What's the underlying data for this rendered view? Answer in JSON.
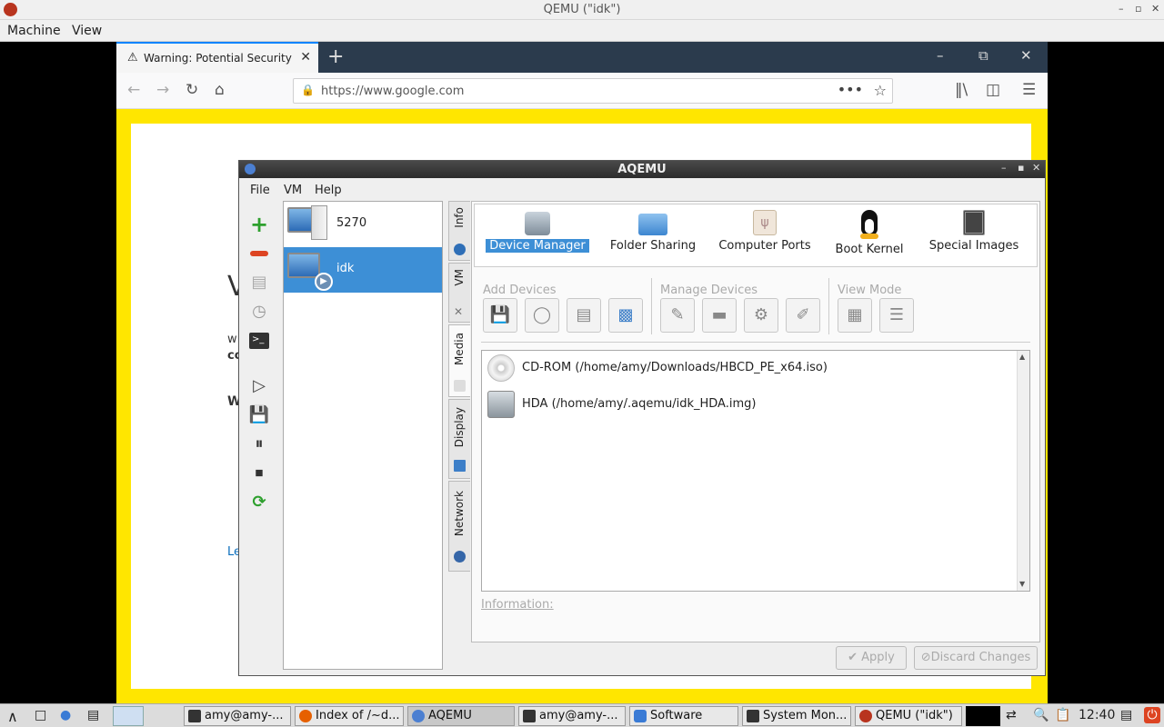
{
  "qemu": {
    "title": "QEMU (\"idk\")",
    "menu": [
      "Machine",
      "View"
    ]
  },
  "firefox": {
    "tab_label": "Warning: Potential Security Risk",
    "new_tab": "+",
    "url": "https://www.google.com"
  },
  "background_page": {
    "heading_fragment": "V",
    "line1": "w",
    "line2": "co",
    "line3": "W",
    "link": "Le"
  },
  "aqemu": {
    "title": "AQEMU",
    "menu": [
      "File",
      "VM",
      "Help"
    ],
    "vms": [
      {
        "name": "5270",
        "selected": false
      },
      {
        "name": "idk",
        "selected": true
      }
    ],
    "side_tabs": [
      "Info",
      "VM",
      "Media",
      "Display",
      "Network"
    ],
    "top_tabs": [
      {
        "label": "Device Manager",
        "icon": "hard-disk-icon",
        "active": true
      },
      {
        "label": "Folder Sharing",
        "icon": "folder-icon",
        "active": false
      },
      {
        "label": "Computer Ports",
        "icon": "usb-icon",
        "active": false
      },
      {
        "label": "Boot Kernel",
        "icon": "tux-icon",
        "active": false
      },
      {
        "label": "Special Images",
        "icon": "chip-icon",
        "active": false
      }
    ],
    "groups": {
      "add": "Add Devices",
      "manage": "Manage Devices",
      "view": "View Mode"
    },
    "devices": [
      {
        "label": "CD-ROM (/home/amy/Downloads/HBCD_PE_x64.iso)",
        "icon": "cdrom-icon"
      },
      {
        "label": "HDA (/home/amy/.aqemu/idk_HDA.img)",
        "icon": "hard-disk-icon"
      }
    ],
    "information_label": "Information:",
    "apply": "Apply",
    "discard": "Discard Changes"
  },
  "taskbar": {
    "items": [
      {
        "label": "amy@amy-...",
        "icon": "terminal-icon",
        "color": "#333333"
      },
      {
        "label": "Index of /~d...",
        "icon": "firefox-icon",
        "color": "#e66000"
      },
      {
        "label": "AQEMU",
        "icon": "aqemu-icon",
        "color": "#4b7fd1",
        "active": true
      },
      {
        "label": "amy@amy-...",
        "icon": "terminal-icon",
        "color": "#333333"
      },
      {
        "label": "Software",
        "icon": "software-icon",
        "color": "#3a7bd5"
      },
      {
        "label": "System Mon...",
        "icon": "monitor-icon",
        "color": "#333333"
      },
      {
        "label": "QEMU (\"idk\")",
        "icon": "qemu-icon",
        "color": "#b8341e"
      }
    ],
    "clock": "12:40"
  }
}
